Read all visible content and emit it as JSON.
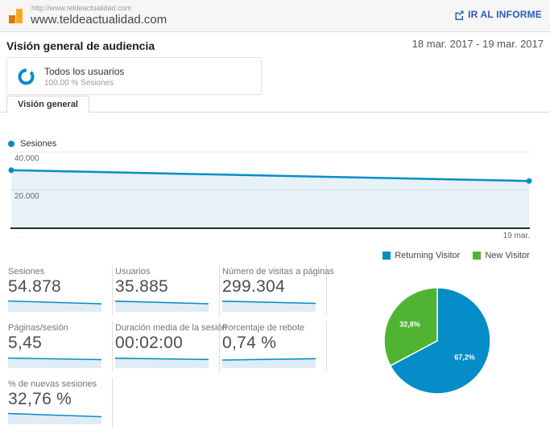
{
  "header": {
    "url_small": "http://www.teldeactualidad.com",
    "site": "www.teldeactualidad.com",
    "report_link": "IR AL INFORME"
  },
  "overview": {
    "title": "Visión general de audiencia",
    "date_range": "18 mar. 2017 - 19 mar. 2017"
  },
  "segment": {
    "name": "Todos los usuarios",
    "detail": "100.00 % Sesiones"
  },
  "tabs": [
    {
      "label": "Visión general"
    }
  ],
  "timeline_legend": "Sesiones",
  "metrics": {
    "rows": [
      [
        {
          "label": "Sesiones",
          "value": "54.878",
          "spark": [
            0.9,
            0.55
          ]
        },
        {
          "label": "Usuarios",
          "value": "35.885",
          "spark": [
            0.88,
            0.55
          ]
        },
        {
          "label": "Número de visitas a páginas",
          "value": "299.304",
          "spark": [
            0.88,
            0.6
          ]
        }
      ],
      [
        {
          "label": "Páginas/sesión",
          "value": "5,45",
          "spark": [
            0.8,
            0.6
          ]
        },
        {
          "label": "Duración media de la sesión",
          "value": "00:02:00",
          "spark": [
            0.78,
            0.62
          ]
        },
        {
          "label": "Porcentaje de rebote",
          "value": "0,74 %",
          "spark": [
            0.55,
            0.72
          ]
        }
      ],
      [
        {
          "label": "% de nuevas sesiones",
          "value": "32,76 %",
          "spark": [
            0.9,
            0.5
          ]
        }
      ]
    ]
  },
  "chart_data": [
    {
      "type": "area",
      "title": "Sesiones",
      "x": [
        "18 mar.",
        "19 mar."
      ],
      "values": [
        30300,
        24600
      ],
      "ylim": [
        0,
        40000
      ],
      "yticks": [
        40000,
        20000
      ],
      "ytick_labels": [
        "40.000",
        "20.000"
      ],
      "x_axis_right_label": "19 mar.",
      "x_axis_left_mark": "…",
      "line_color": "#058dc7",
      "area_color": "#e7f1f8",
      "grid": true,
      "legend_position": "top-left"
    },
    {
      "type": "pie",
      "title": "New vs Returning",
      "series": [
        {
          "name": "Returning Visitor",
          "value": 67.2,
          "label": "67,2%",
          "color": "#058dc7"
        },
        {
          "name": "New Visitor",
          "value": 32.8,
          "label": "32,8%",
          "color": "#50b432"
        }
      ],
      "legend_position": "top"
    }
  ],
  "colors": {
    "accent_blue": "#058dc7",
    "green": "#50b432",
    "link_blue": "#2a5db4"
  }
}
